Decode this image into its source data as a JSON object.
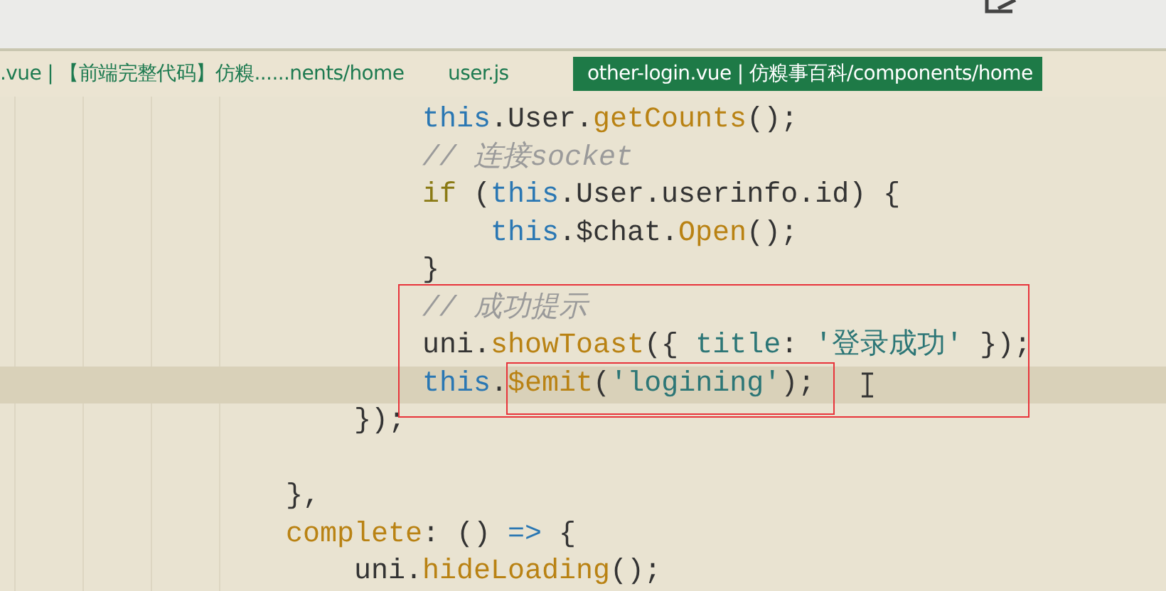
{
  "tabs": [
    {
      "label": ".vue | 【前端完整代码】仿糗......nents/home",
      "selected": false
    },
    {
      "label": "user.js",
      "selected": false
    },
    {
      "label": "other-login.vue | 仿糗事百科/components/home",
      "selected": true
    }
  ],
  "code_lines": [
    {
      "kind": "group",
      "children": [
        {
          "kind": "group",
          "children": [
            {
              "kind": "code",
              "current": false,
              "tokens": [
                {
                  "text": "this",
                  "kind": "keyword"
                },
                {
                  "text": ".User.",
                  "kind": "plain"
                },
                {
                  "text": "getCounts",
                  "kind": "method"
                },
                {
                  "text": "();",
                  "kind": "plain"
                }
              ]
            },
            {
              "kind": "code",
              "current": false,
              "tokens": [
                {
                  "text": "// 连接socket",
                  "kind": "comment"
                }
              ]
            },
            {
              "kind": "code",
              "current": false,
              "tokens": [
                {
                  "text": "if",
                  "kind": "control"
                },
                {
                  "text": " (",
                  "kind": "plain"
                },
                {
                  "text": "this",
                  "kind": "keyword"
                },
                {
                  "text": ".User.userinfo.id) {",
                  "kind": "plain"
                }
              ],
              "children": [
                {
                  "kind": "code",
                  "current": false,
                  "tokens": [
                    {
                      "text": "this",
                      "kind": "keyword"
                    },
                    {
                      "text": ".$chat.",
                      "kind": "plain"
                    },
                    {
                      "text": "Open",
                      "kind": "method"
                    },
                    {
                      "text": "();",
                      "kind": "plain"
                    }
                  ]
                }
              ]
            },
            {
              "kind": "code",
              "current": false,
              "tokens": [
                {
                  "text": "}",
                  "kind": "plain"
                }
              ]
            },
            {
              "kind": "code",
              "current": false,
              "tokens": [
                {
                  "text": "// 成功提示",
                  "kind": "comment"
                }
              ]
            },
            {
              "kind": "code",
              "current": false,
              "tokens": [
                {
                  "text": "uni.",
                  "kind": "plain"
                },
                {
                  "text": "showToast",
                  "kind": "method"
                },
                {
                  "text": "({ ",
                  "kind": "plain"
                },
                {
                  "text": "title",
                  "kind": "string"
                },
                {
                  "text": ": ",
                  "kind": "plain"
                },
                {
                  "text": "'登录成功'",
                  "kind": "string"
                },
                {
                  "text": " });",
                  "kind": "plain"
                }
              ]
            },
            {
              "kind": "code",
              "current": true,
              "tokens": [
                {
                  "text": "this",
                  "kind": "keyword"
                },
                {
                  "text": ".",
                  "kind": "plain"
                },
                {
                  "text": "$emit",
                  "kind": "method"
                },
                {
                  "text": "(",
                  "kind": "plain"
                },
                {
                  "text": "'logining'",
                  "kind": "string"
                },
                {
                  "text": ");",
                  "kind": "plain"
                }
              ]
            }
          ]
        },
        {
          "kind": "code",
          "current": false,
          "tokens": [
            {
              "text": "});",
              "kind": "plain"
            }
          ]
        }
      ]
    },
    {
      "kind": "blank"
    },
    {
      "kind": "code",
      "current": false,
      "tokens": [
        {
          "text": "},",
          "kind": "plain"
        }
      ]
    },
    {
      "kind": "code",
      "current": false,
      "tokens": [
        {
          "text": "complete",
          "kind": "method"
        },
        {
          "text": ": () ",
          "kind": "plain"
        },
        {
          "text": "=>",
          "kind": "keyword"
        },
        {
          "text": " {",
          "kind": "plain"
        }
      ],
      "children": [
        {
          "kind": "code",
          "current": false,
          "tokens": [
            {
              "text": "uni.",
              "kind": "plain"
            },
            {
              "text": "hideLoading",
              "kind": "method"
            },
            {
              "text": "();",
              "kind": "plain"
            }
          ]
        }
      ]
    }
  ]
}
